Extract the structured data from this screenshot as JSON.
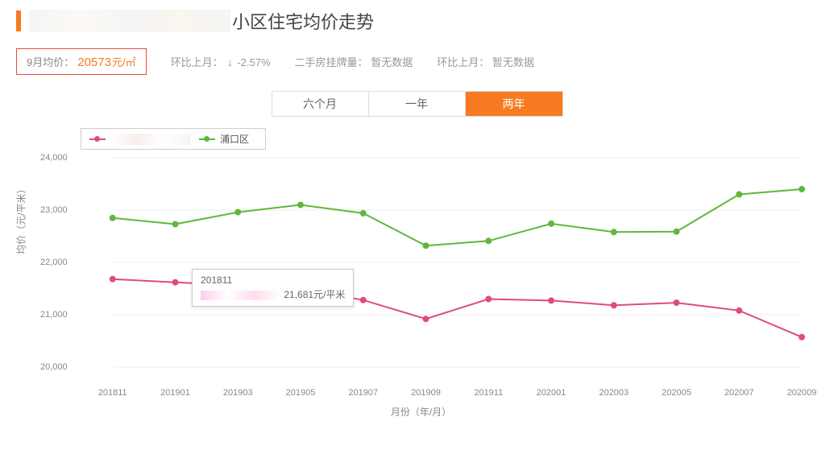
{
  "header": {
    "title": "小区住宅均价走势"
  },
  "info": {
    "avg_label": "9月均价：",
    "avg_value": "20573",
    "avg_unit": "元/㎡",
    "mom_label": "环比上月：",
    "mom_value": "-2.57%",
    "listing_label": "二手房挂牌量：",
    "listing_value": "暂无数据",
    "mom2_label": "环比上月：",
    "mom2_value": "暂无数据"
  },
  "tabs": [
    {
      "label": "六个月",
      "active": false
    },
    {
      "label": "一年",
      "active": false
    },
    {
      "label": "两年",
      "active": true
    }
  ],
  "tooltip": {
    "date": "201811",
    "value": "21,681元/平米"
  },
  "chart_data": {
    "type": "line",
    "title": "小区住宅均价走势",
    "xlabel": "月份（年/月）",
    "ylabel": "均价（元/平米）",
    "ylim": [
      20000,
      24000
    ],
    "yticks": [
      20000,
      21000,
      22000,
      23000,
      24000
    ],
    "categories": [
      "201811",
      "201901",
      "201903",
      "201905",
      "201907",
      "201909",
      "201911",
      "202001",
      "202003",
      "202005",
      "202007",
      "202009"
    ],
    "series": [
      {
        "name": "(小区)",
        "color": "#e14b7b",
        "values": [
          21681,
          21620,
          21560,
          21500,
          21280,
          20920,
          21300,
          21270,
          21180,
          21230,
          21080,
          20573
        ]
      },
      {
        "name": "浦口区",
        "color": "#5fb83a",
        "values": [
          22850,
          22730,
          22960,
          23100,
          22940,
          22320,
          22410,
          22740,
          22580,
          22590,
          23300,
          23400
        ]
      }
    ]
  }
}
